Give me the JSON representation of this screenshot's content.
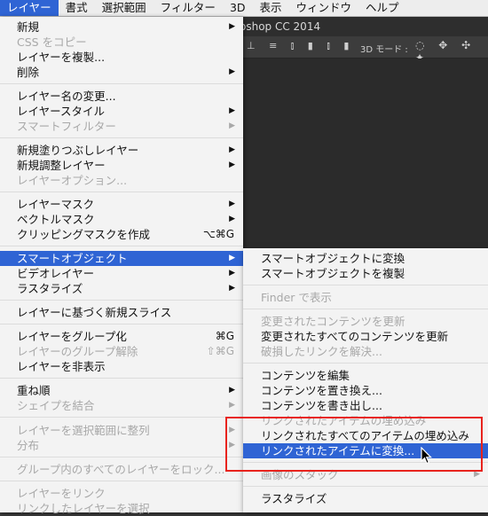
{
  "menubar": {
    "items": [
      "レイヤー",
      "書式",
      "選択範囲",
      "フィルター",
      "3D",
      "表示",
      "ウィンドウ",
      "ヘルプ"
    ],
    "active_index": 0,
    "accent": "#2f64d4"
  },
  "app": {
    "title_fragment": "oshop CC 2014",
    "toolbar_3d_label": "3D モード :"
  },
  "main_menu": {
    "items": [
      {
        "label": "新規",
        "submenu": true,
        "enabled": true
      },
      {
        "label": "CSS をコピー",
        "enabled": false
      },
      {
        "label": "レイヤーを複製...",
        "enabled": true
      },
      {
        "label": "削除",
        "submenu": true,
        "enabled": true
      },
      {
        "label": "レイヤー名の変更...",
        "enabled": true
      },
      {
        "label": "レイヤースタイル",
        "submenu": true,
        "enabled": true
      },
      {
        "label": "スマートフィルター",
        "submenu": true,
        "enabled": false
      },
      {
        "label": "新規塗りつぶしレイヤー",
        "submenu": true,
        "enabled": true
      },
      {
        "label": "新規調整レイヤー",
        "submenu": true,
        "enabled": true
      },
      {
        "label": "レイヤーオプション...",
        "enabled": false
      },
      {
        "label": "レイヤーマスク",
        "submenu": true,
        "enabled": true
      },
      {
        "label": "ベクトルマスク",
        "submenu": true,
        "enabled": true
      },
      {
        "label": "クリッピングマスクを作成",
        "shortcut": "⌥⌘G",
        "enabled": true
      },
      {
        "label": "スマートオブジェクト",
        "submenu": true,
        "enabled": true,
        "highlighted": true
      },
      {
        "label": "ビデオレイヤー",
        "submenu": true,
        "enabled": true
      },
      {
        "label": "ラスタライズ",
        "submenu": true,
        "enabled": true
      },
      {
        "label": "レイヤーに基づく新規スライス",
        "enabled": true
      },
      {
        "label": "レイヤーをグループ化",
        "shortcut": "⌘G",
        "enabled": true
      },
      {
        "label": "レイヤーのグループ解除",
        "shortcut": "⇧⌘G",
        "enabled": false
      },
      {
        "label": "レイヤーを非表示",
        "enabled": true
      },
      {
        "label": "重ね順",
        "submenu": true,
        "enabled": true
      },
      {
        "label": "シェイプを結合",
        "submenu": true,
        "enabled": false
      },
      {
        "label": "レイヤーを選択範囲に整列",
        "submenu": true,
        "enabled": false
      },
      {
        "label": "分布",
        "submenu": true,
        "enabled": false
      },
      {
        "label": "グループ内のすべてのレイヤーをロック...",
        "enabled": false
      },
      {
        "label": "レイヤーをリンク",
        "enabled": false
      },
      {
        "label": "リンクしたレイヤーを選択",
        "enabled": false
      }
    ]
  },
  "submenu": {
    "items": [
      {
        "label": "スマートオブジェクトに変換",
        "enabled": true
      },
      {
        "label": "スマートオブジェクトを複製",
        "enabled": true
      },
      {
        "label": "Finder で表示",
        "enabled": false
      },
      {
        "label": "変更されたコンテンツを更新",
        "enabled": false
      },
      {
        "label": "変更されたすべてのコンテンツを更新",
        "enabled": true
      },
      {
        "label": "破損したリンクを解決...",
        "enabled": false
      },
      {
        "label": "コンテンツを編集",
        "enabled": true
      },
      {
        "label": "コンテンツを置き換え...",
        "enabled": true
      },
      {
        "label": "コンテンツを書き出し...",
        "enabled": true
      },
      {
        "label": "リンクされたアイテムの埋め込み",
        "enabled": false
      },
      {
        "label": "リンクされたすべてのアイテムの埋め込み",
        "enabled": true
      },
      {
        "label": "リンクされたアイテムに変換...",
        "enabled": true,
        "highlighted": true
      },
      {
        "label": "画像のスタック",
        "submenu": true,
        "enabled": false
      },
      {
        "label": "ラスタライズ",
        "enabled": true
      }
    ]
  },
  "annotation": {
    "color": "#e8231d"
  },
  "icons": {
    "submenu_arrow": "▶",
    "cursor": "arrow-cursor-icon"
  }
}
